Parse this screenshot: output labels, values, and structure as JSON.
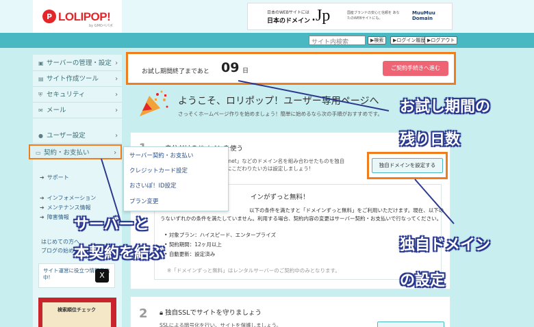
{
  "header": {
    "logo_mark": "P",
    "logo_text": "LOLIPOP!",
    "logo_sub": "by GMOペパボ",
    "banner_line1": "日本のWEBサイトには",
    "banner_line2": "日本のドメイン",
    "banner_jp": ".Jp",
    "banner_right": "国産ブランドの安心と信頼を あなたのWEBサイトにも。",
    "banner_brand": "MuuMuu Domain",
    "search_placeholder": "サイト内検索",
    "btn_search": "▶検索",
    "btn_login_history": "▶ログイン履歴",
    "btn_logout": "▶ログアウト"
  },
  "sidebar": {
    "items": [
      {
        "icon": "▣",
        "label": "サーバーの管理・設定"
      },
      {
        "icon": "▤",
        "label": "サイト作成ツール"
      },
      {
        "icon": "⛨",
        "label": "セキュリティ"
      },
      {
        "icon": "✉",
        "label": "メール"
      },
      {
        "icon": "●",
        "label": "ユーザー設定"
      },
      {
        "icon": "▭",
        "label": "契約・お支払い"
      }
    ],
    "arrow": "›",
    "support": "サポート",
    "links": [
      "インフォメーション",
      "メンテナンス情報",
      "障害情報"
    ],
    "beginner": "はじめての方へ",
    "blog": "ブログの始め方",
    "news": "サイト運営に役立つ情報発信中!",
    "x_label": "X",
    "promo": "検索順位チェック"
  },
  "dropdown": {
    "items": [
      "サーバー契約・お支払い",
      "クレジットカード設定",
      "おさいぽ！ID設定",
      "プラン変更"
    ]
  },
  "trial": {
    "label": "お試し期間終了まであと",
    "days": "09",
    "unit": "日",
    "button": "ご契約手続きへ進む"
  },
  "welcome": {
    "title": "ようこそ、ロリポップ！ユーザー専用ページへ",
    "subtitle": "さっそくホームページ作りを始めましょう！簡単に始めるなら次の手順がおすすめです。"
  },
  "step1": {
    "num": "1",
    "title": "自分だけのドメインを使う",
    "desc": ".net」などのドメイン名を組み合わせたものを独自 にこだわりたい方は設定しましょう!",
    "button": "独自ドメインを設定する",
    "inner_title": "インがずっと無料！",
    "inner_text1": "以下の条件を満たすと「ドメインずっと無料」をご利用いただけます。現在、以下の",
    "inner_text2": "うないずれかの条件を満たしていません。利用する場合、契約内容の変更はサーバー契約・お支払いで行なってください。",
    "bullets": [
      "対象プラン：ハイスピード、エンタープライズ",
      "契約期間：12ヶ月以上",
      "自動更新：設定済み"
    ],
    "note": "※「ドメインずっと無料」はレンタルサーバーのご契約中のみとなります。"
  },
  "step2": {
    "num": "2",
    "title": "独自SSLでサイトを守りましょう",
    "desc": "SSLによる暗号化を行い、サイトを保護しましょう。"
  },
  "annotations": {
    "trial_days_l1": "お試し期間の",
    "trial_days_l2": "残り日数",
    "contract_l1": "サーバーと",
    "contract_l2": "本契約を結ぶ",
    "domain_l1": "独自ドメイン",
    "domain_l2": "の設定"
  },
  "colors": {
    "accent": "#4ab8c3",
    "highlight": "#f07c1b",
    "brand": "#e4262b",
    "cta": "#ef6474",
    "annotation": "#2b3a8f"
  }
}
